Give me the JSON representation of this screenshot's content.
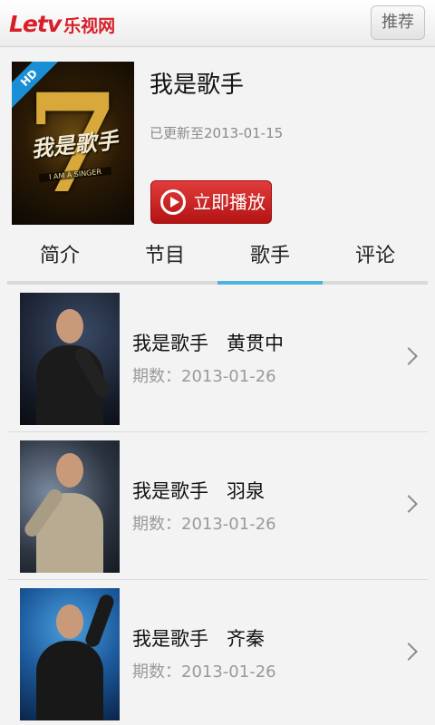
{
  "header": {
    "logo_latin_a": "Le",
    "logo_latin_b": "tv",
    "logo_cn": "乐视网",
    "recommend_label": "推荐"
  },
  "show": {
    "title": "我是歌手",
    "updated": "已更新至2013-01-15",
    "play_label": "立即播放",
    "hd_badge": "HD",
    "poster_number": "7",
    "poster_title": "我是歌手",
    "poster_subtitle": "I AM A SINGER"
  },
  "tabs": [
    {
      "label": "简介",
      "active": false
    },
    {
      "label": "节目",
      "active": false
    },
    {
      "label": "歌手",
      "active": true
    },
    {
      "label": "评论",
      "active": false
    }
  ],
  "singers": [
    {
      "title": "我是歌手   黄贯中",
      "date": "期数：2013-01-26"
    },
    {
      "title": "我是歌手   羽泉",
      "date": "期数：2013-01-26"
    },
    {
      "title": "我是歌手   齐秦",
      "date": "期数：2013-01-26"
    }
  ],
  "colors": {
    "brand": "#d81e28",
    "play_button": "#c82222",
    "tab_indicator": "#4fb2de",
    "hd_badge": "#1a8fd6"
  },
  "icons": {
    "play": "play-circle-icon",
    "chevron": "chevron-right-icon"
  }
}
